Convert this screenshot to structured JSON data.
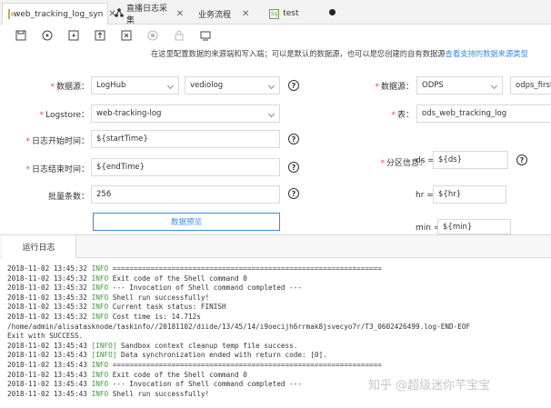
{
  "tabs": [
    {
      "label": "web_tracking_log_syn"
    },
    {
      "label": "直播日志采集"
    },
    {
      "label": "业务流程"
    },
    {
      "label": "test"
    }
  ],
  "hint": {
    "text": "在这里配置数据的来源端和写入端；可以是默认的数据源，也可以是您创建的自有数据源",
    "link": "查看支持的数据来源类型"
  },
  "source": {
    "datasource_label": "数据源：",
    "datasource_type": "LogHub",
    "datasource_name": "vediolog",
    "logstore_label": "Logstore：",
    "logstore_value": "web-tracking-log",
    "start_label": "日志开始时间：",
    "start_value": "${startTime}",
    "end_label": "日志结束时间：",
    "end_value": "${endTime}",
    "batch_label": "批量条数：",
    "batch_value": "256",
    "preview_button": "数据预览"
  },
  "target": {
    "datasource_label": "数据源：",
    "datasource_type": "ODPS",
    "datasource_name": "odps_first",
    "table_label": "表：",
    "table_value": "ods_web_tracking_log",
    "partition_label": "分区信息：",
    "ds_label": "ds =",
    "ds_value": "${ds}",
    "hr_label": "hr =",
    "hr_value": "${hr}",
    "min_label": "min =",
    "min_value": "${min}"
  },
  "log": {
    "tab_label": "运行日志",
    "lines": [
      {
        "ts": "2018-11-02 13:45:32",
        "level": "INFO",
        "msg": "================================================================"
      },
      {
        "ts": "2018-11-02 13:45:32",
        "level": "INFO",
        "msg": "Exit code of the Shell command 0"
      },
      {
        "ts": "2018-11-02 13:45:32",
        "level": "INFO",
        "msg": "--- Invocation of Shell command completed ---"
      },
      {
        "ts": "2018-11-02 13:45:32",
        "level": "INFO",
        "msg": "Shell run successfully!"
      },
      {
        "ts": "2018-11-02 13:45:32",
        "level": "INFO",
        "msg": "Current task status: FINISH"
      },
      {
        "ts": "2018-11-02 13:45:32",
        "level": "INFO",
        "msg": "Cost time is: 14.712s"
      },
      {
        "raw": "/home/admin/alisatasknode/taskinfo//20181102/diide/13/45/14/i9oecijh6rrmak8jsvecyo7r/T3_0602426499.log-END-EOF"
      },
      {
        "raw": "Exit with SUCCESS."
      },
      {
        "ts": "2018-11-02 13:45:43",
        "level": "[INFO]",
        "msg": "Sandbox context cleanup temp file success."
      },
      {
        "ts": "2018-11-02 13:45:43",
        "level": "[INFO]",
        "msg": "Data synchronization ended with return code: [0]."
      },
      {
        "ts": "2018-11-02 13:45:43",
        "level": "INFO",
        "msg": "================================================================"
      },
      {
        "ts": "2018-11-02 13:45:43",
        "level": "INFO",
        "msg": "Exit code of the Shell command 0"
      },
      {
        "ts": "2018-11-02 13:45:43",
        "level": "INFO",
        "msg": "--- Invocation of Shell command completed ---"
      },
      {
        "ts": "2018-11-02 13:45:43",
        "level": "INFO",
        "msg": "Shell run successfully!"
      }
    ]
  },
  "watermark": "知乎 @超级迷你芊宝宝"
}
